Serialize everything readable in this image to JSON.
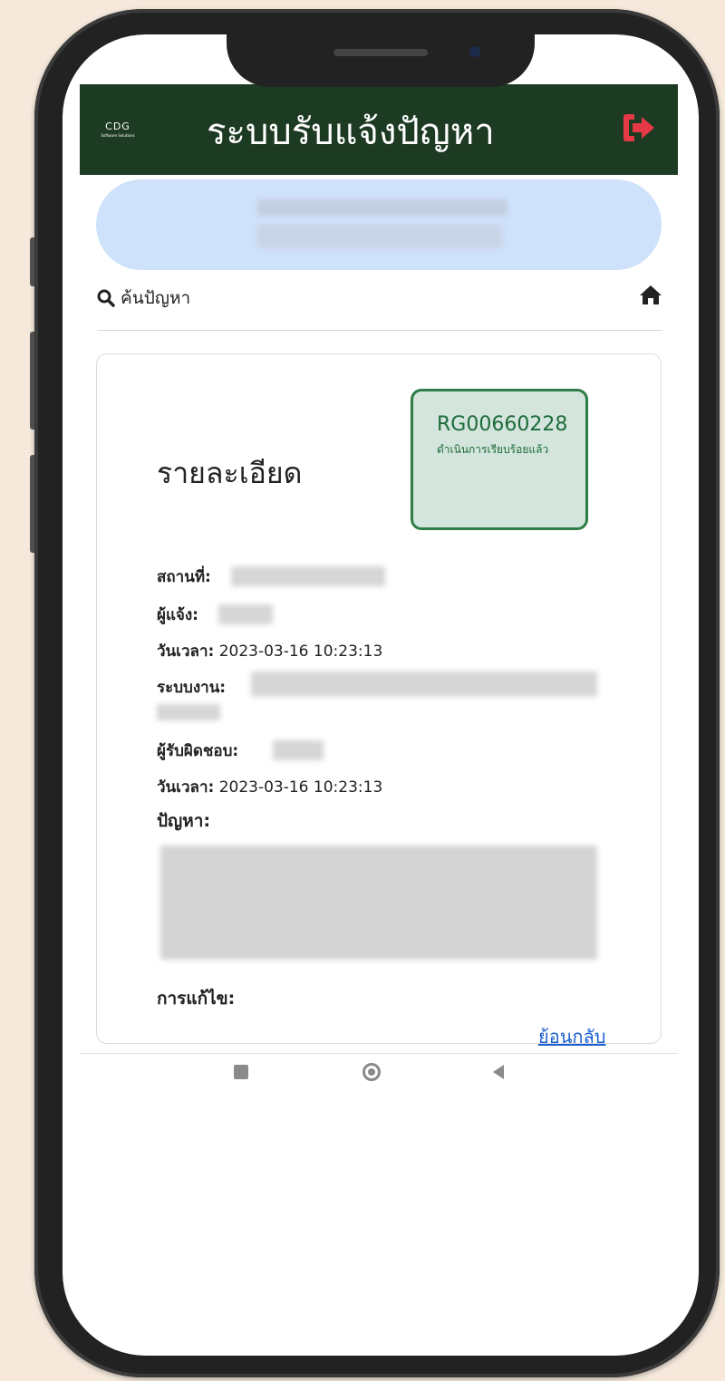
{
  "header": {
    "logo_text": "CDG",
    "logo_subtext": "Software Solutions",
    "title": "ระบบรับแจ้งปัญหา",
    "exit_icon": "sign-out-icon",
    "exit_color": "#e53946"
  },
  "search": {
    "label": "ค้นปัญหา",
    "icon": "search-icon",
    "home_icon": "home-icon"
  },
  "detail": {
    "title": "รายละเอียด",
    "case_id": "RG00660228",
    "case_status": "ดำเนินการเรียบร้อยแล้ว",
    "fields": {
      "location_label": "สถานที่:",
      "reporter_label": "ผู้แจ้ง:",
      "datetime1_label": "วันเวลา:",
      "datetime1_value": "2023-03-16 10:23:13",
      "system_label": "ระบบงาน:",
      "responsible_label": "ผู้รับผิดชอบ:",
      "datetime2_label": "วันเวลา:",
      "datetime2_value": "2023-03-16 10:23:13",
      "problem_label": "ปัญหา:",
      "solution_label": "การแก้ไข:"
    },
    "back_link": "ย้อนกลับ"
  },
  "colors": {
    "header_bg": "#1d3a22",
    "pill_bg": "#cfe2fb",
    "status_bg": "#d3e5dc",
    "status_border": "#2e7d46",
    "link": "#1a5fd1",
    "page_bg": "#f6e9dc"
  },
  "navbar": {
    "items": [
      "recent-apps-icon",
      "home-button-icon",
      "back-icon"
    ]
  }
}
